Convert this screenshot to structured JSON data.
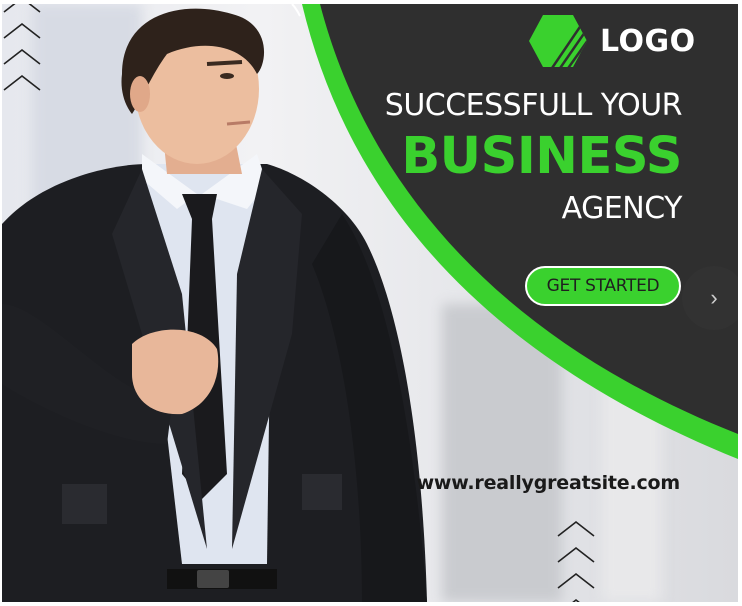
{
  "brand": {
    "logo_text": "LOGO",
    "logo_icon": "hexagon-stripes-icon",
    "accent_color": "#3ad12e",
    "dark_color": "#2f2f2f"
  },
  "headline": {
    "line1": "SUCCESSFULL YOUR",
    "line2": "BUSINESS",
    "line3": "AGENCY"
  },
  "cta": {
    "label": "GET STARTED"
  },
  "navigation": {
    "next_icon": "chevron-right-icon"
  },
  "footer": {
    "website": "www.reallygreatsite.com"
  },
  "decor": {
    "top_left": "chevrons-up-icon",
    "bottom_right": "chevrons-up-icon"
  }
}
